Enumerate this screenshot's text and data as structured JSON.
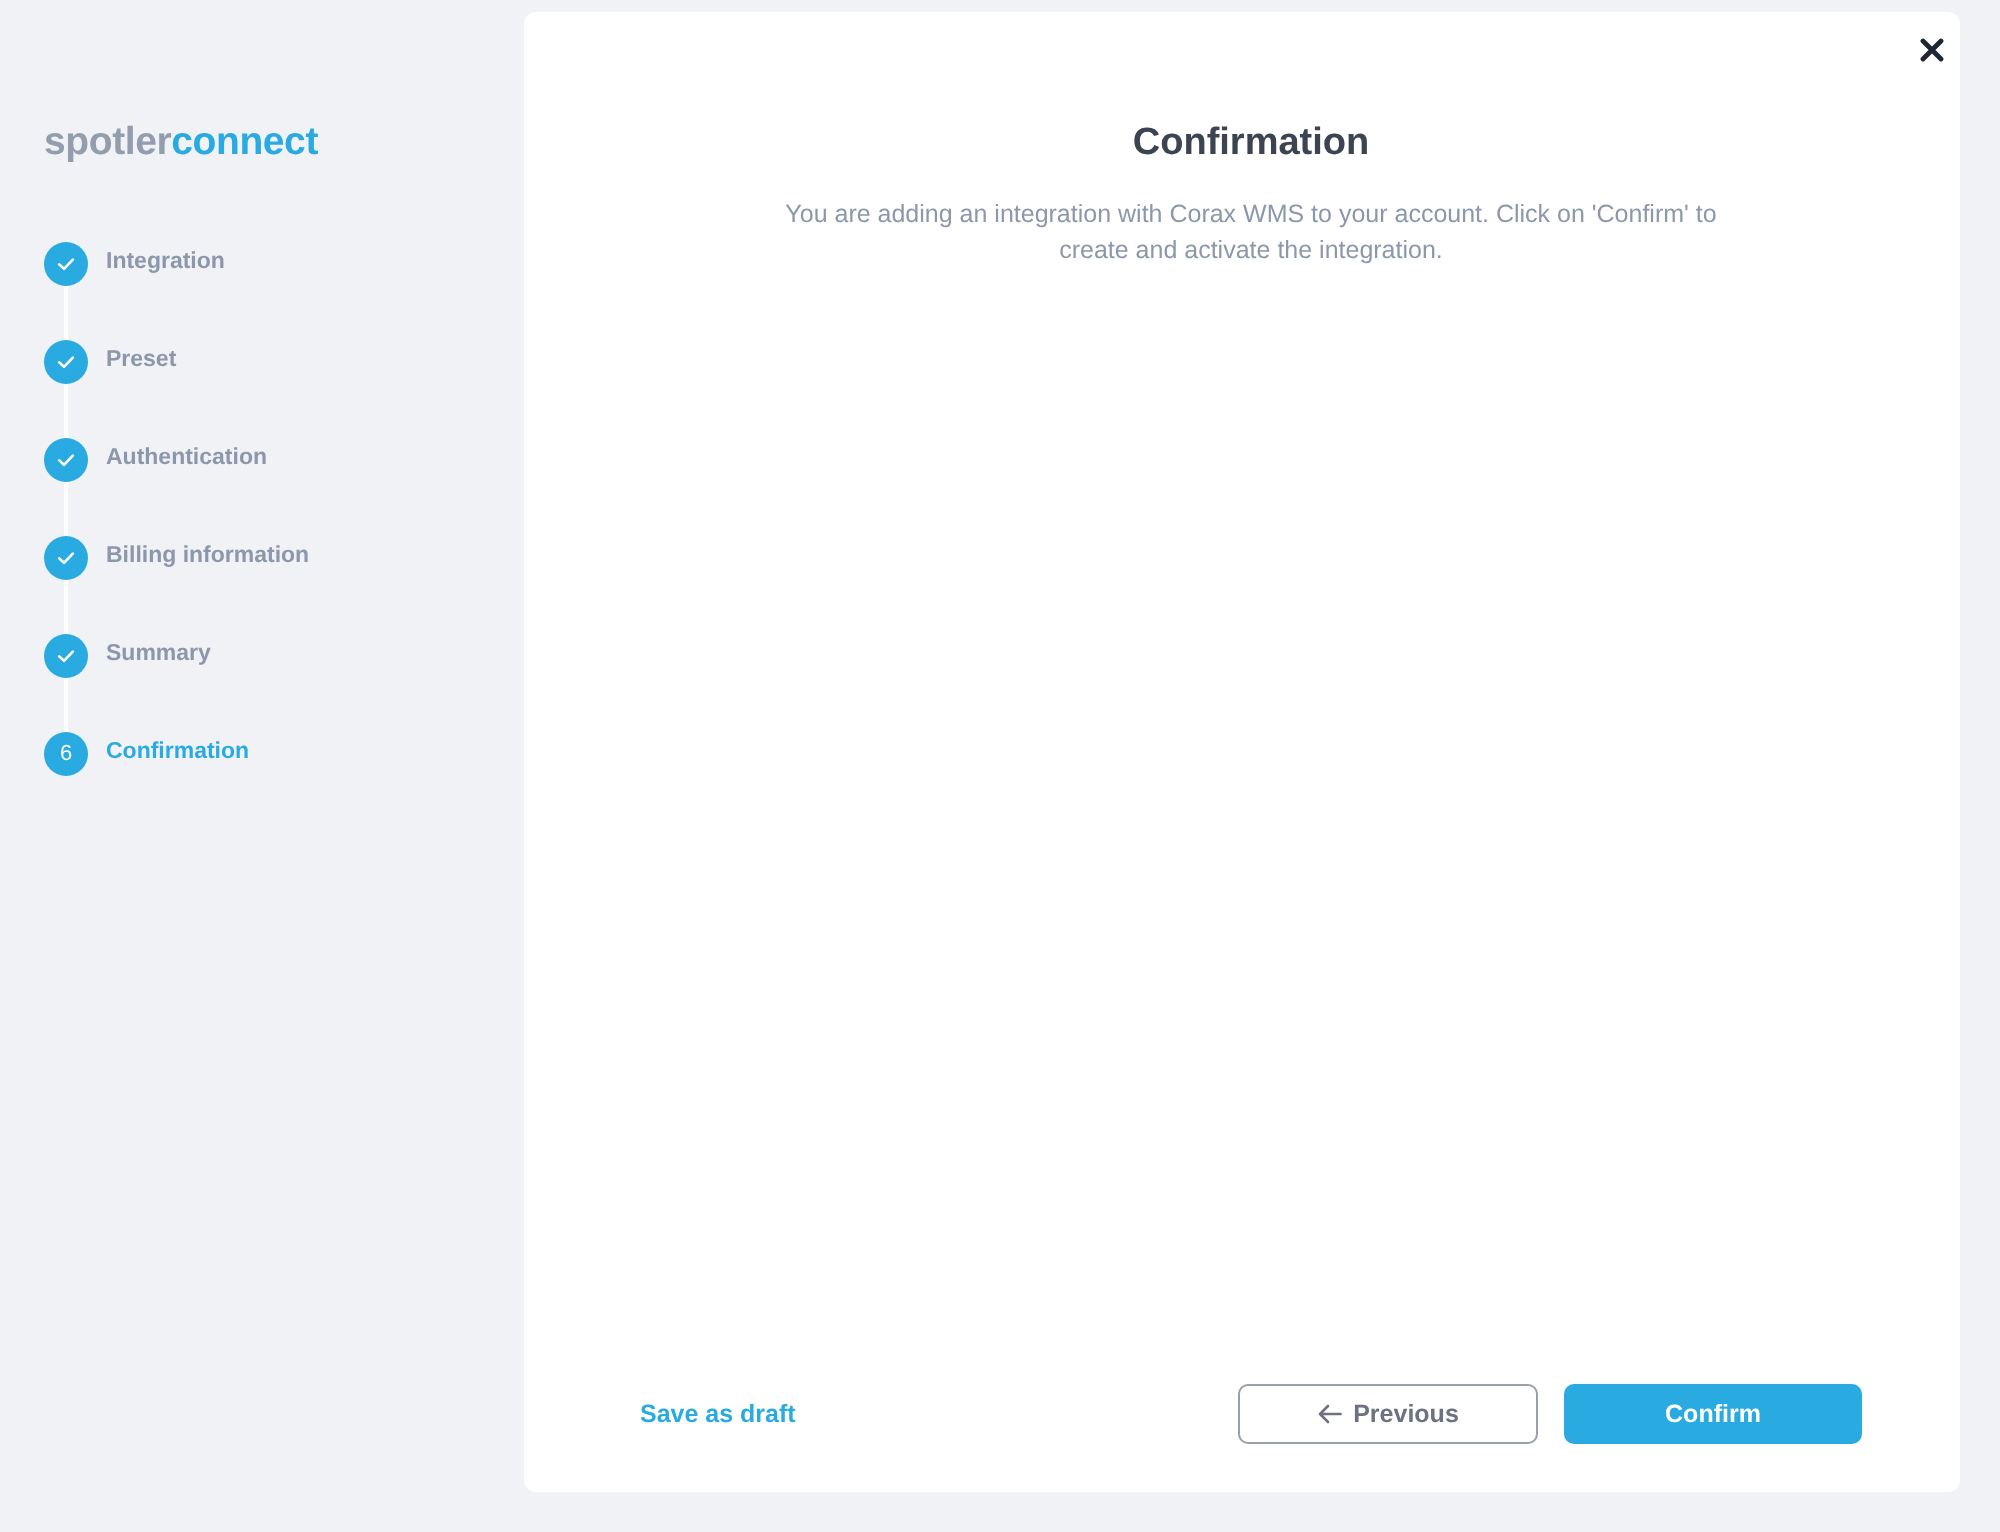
{
  "logo": {
    "parts": [
      {
        "text": "spotler",
        "kind": "plain"
      },
      {
        "text": "connect",
        "kind": "accent"
      }
    ]
  },
  "steps": [
    {
      "label": "Integration",
      "completed": true,
      "selected": false
    },
    {
      "label": "Preset",
      "completed": true,
      "selected": false
    },
    {
      "label": "Authentication",
      "completed": true,
      "selected": false
    },
    {
      "label": "Billing information",
      "completed": true,
      "selected": false
    },
    {
      "label": "Summary",
      "completed": true,
      "selected": false
    },
    {
      "label": "Confirmation",
      "number": "6",
      "completed": false,
      "selected": true
    }
  ],
  "dialog": {
    "title": "Confirmation",
    "description": "You are adding an integration with Corax WMS to your account. Click on 'Confirm' to create and activate the integration."
  },
  "footer": {
    "save_draft": "Save as draft",
    "previous": "Previous",
    "confirm": "Confirm"
  }
}
